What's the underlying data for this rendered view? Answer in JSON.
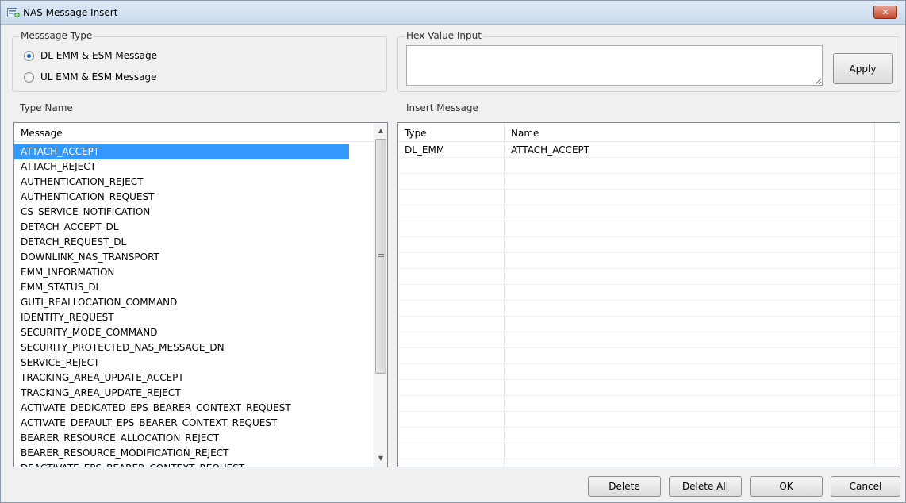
{
  "window": {
    "title": "NAS Message Insert",
    "close_label": "✕"
  },
  "message_type": {
    "label": "Messsage Type",
    "options": [
      {
        "label": "DL EMM & ESM Message",
        "checked": true
      },
      {
        "label": "UL EMM & ESM Message",
        "checked": false
      }
    ]
  },
  "hex_input": {
    "label": "Hex Value Input",
    "value": "",
    "apply_label": "Apply"
  },
  "type_name": {
    "label": "Type Name",
    "column": "Message",
    "selected_index": 0,
    "items": [
      "ATTACH_ACCEPT",
      "ATTACH_REJECT",
      "AUTHENTICATION_REJECT",
      "AUTHENTICATION_REQUEST",
      "CS_SERVICE_NOTIFICATION",
      "DETACH_ACCEPT_DL",
      "DETACH_REQUEST_DL",
      "DOWNLINK_NAS_TRANSPORT",
      "EMM_INFORMATION",
      "EMM_STATUS_DL",
      "GUTI_REALLOCATION_COMMAND",
      "IDENTITY_REQUEST",
      "SECURITY_MODE_COMMAND",
      "SECURITY_PROTECTED_NAS_MESSAGE_DN",
      "SERVICE_REJECT",
      "TRACKING_AREA_UPDATE_ACCEPT",
      "TRACKING_AREA_UPDATE_REJECT",
      "ACTIVATE_DEDICATED_EPS_BEARER_CONTEXT_REQUEST",
      "ACTIVATE_DEFAULT_EPS_BEARER_CONTEXT_REQUEST",
      "BEARER_RESOURCE_ALLOCATION_REJECT",
      "BEARER_RESOURCE_MODIFICATION_REJECT",
      "DEACTIVATE_EPS_BEARER_CONTEXT_REQUEST"
    ]
  },
  "insert_message": {
    "label": "Insert Message",
    "columns": [
      "Type",
      "Name"
    ],
    "rows": [
      {
        "type": "DL_EMM",
        "name": "ATTACH_ACCEPT"
      }
    ]
  },
  "buttons": {
    "delete": "Delete",
    "delete_all": "Delete All",
    "ok": "OK",
    "cancel": "Cancel"
  },
  "icons": {
    "title": "nas-insert-icon",
    "radio": "radio-icon",
    "scroll_up": "scroll-up-icon",
    "scroll_down": "scroll-down-icon"
  },
  "colors": {
    "selection": "#3399ff",
    "close": "#c74a2b"
  }
}
